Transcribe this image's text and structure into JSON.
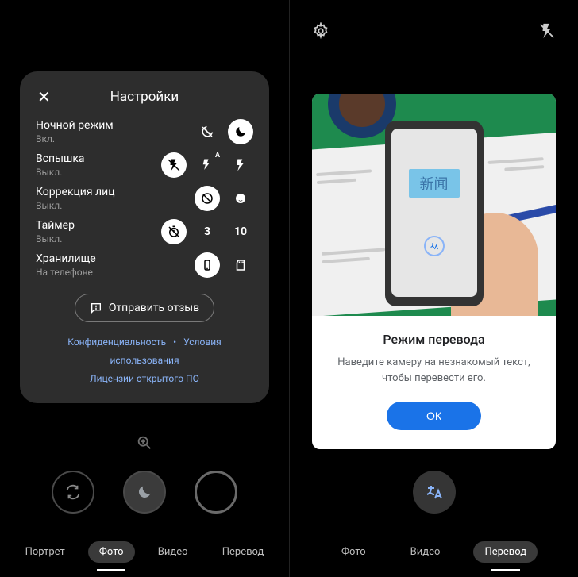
{
  "left": {
    "settings": {
      "title": "Настройки",
      "rows": [
        {
          "label": "Ночной режим",
          "value": "Вкл.",
          "icons": [
            "night-off-icon",
            "moon-icon"
          ],
          "active": 1
        },
        {
          "label": "Вспышка",
          "value": "Выкл.",
          "icons": [
            "flash-off-icon",
            "flash-auto-icon",
            "flash-on-icon"
          ],
          "active": 0,
          "texts": [
            "",
            "A",
            ""
          ]
        },
        {
          "label": "Коррекция лиц",
          "value": "Выкл.",
          "icons": [
            "retouch-off-icon",
            "retouch-on-icon"
          ],
          "active": 0
        },
        {
          "label": "Таймер",
          "value": "Выкл.",
          "icons": [
            "timer-off-icon",
            "timer-3-icon",
            "timer-10-icon"
          ],
          "active": 0,
          "texts": [
            "",
            "3",
            "10"
          ]
        },
        {
          "label": "Хранилище",
          "value": "На телефоне",
          "icons": [
            "phone-storage-icon",
            "sd-card-icon"
          ],
          "active": 0
        }
      ],
      "feedback": "Отправить отзыв",
      "links": {
        "privacy": "Конфиденциальность",
        "terms": "Условия использования",
        "licenses": "Лицензии открытого ПО"
      }
    },
    "tabs": [
      "Портрет",
      "Фото",
      "Видео",
      "Перевод"
    ],
    "activeTab": 1,
    "modeButtons": [
      "switch-camera-icon",
      "night-mode-icon",
      "shutter-icon"
    ]
  },
  "right": {
    "topIcons": [
      "gear-icon",
      "flash-off-icon"
    ],
    "modal": {
      "illustrationText": "新闻",
      "title": "Режим перевода",
      "description": "Наведите камеру на незнакомый текст, чтобы перевести его.",
      "button": "ОК"
    },
    "modeButton": "translate-icon",
    "tabs": [
      "Фото",
      "Видео",
      "Перевод"
    ],
    "activeTab": 2
  }
}
